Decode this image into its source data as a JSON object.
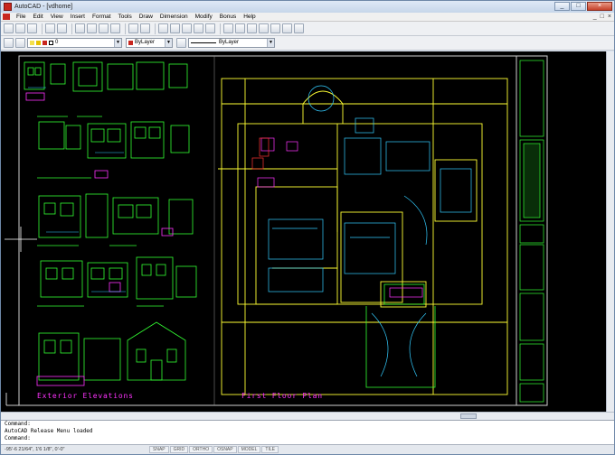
{
  "window": {
    "title": "AutoCAD - [vdhome]",
    "buttons": [
      "_",
      "□",
      "×"
    ]
  },
  "menu": {
    "items": [
      "File",
      "Edit",
      "View",
      "Insert",
      "Format",
      "Tools",
      "Draw",
      "Dimension",
      "Modify",
      "Bonus",
      "Help"
    ],
    "mdi_controls": [
      "_",
      "□",
      "×"
    ]
  },
  "toolbar": {
    "layer_value": "0",
    "color_value": "ByLayer",
    "linetype_value": "ByLayer"
  },
  "drawing": {
    "label_left": "Exterior Elevations",
    "label_right": "First Floor Plan",
    "accent_green": "#33ff33",
    "accent_yellow": "#ffff33",
    "accent_cyan": "#33ccff",
    "accent_magenta": "#ff33ff"
  },
  "command": {
    "lines": [
      "Command:",
      "AutoCAD  Release  Menu  loaded",
      "Command:"
    ]
  },
  "status": {
    "coords": "-95'-6 21/64\", 1'6 1/8\", 0'-0\"",
    "toggles": [
      "SNAP",
      "GRID",
      "ORTHO",
      "OSNAP",
      "MODEL",
      "TILE"
    ]
  }
}
